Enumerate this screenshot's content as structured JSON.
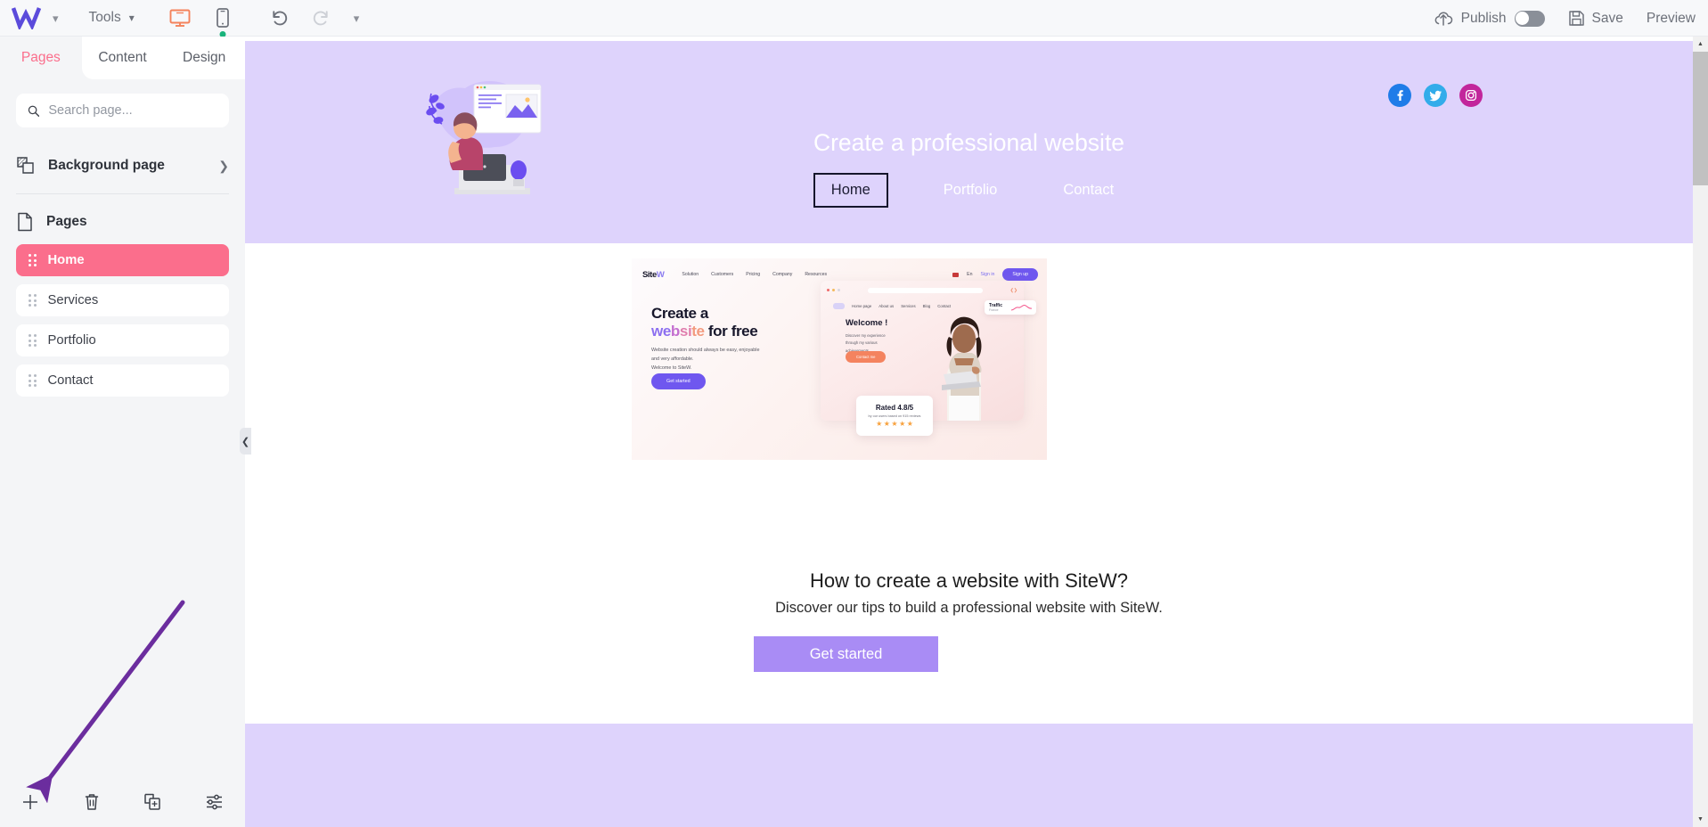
{
  "topbar": {
    "logo": "W",
    "logo_caret_icon": "chevron-down-icon",
    "tools_label": "Tools",
    "tools_caret_icon": "chevron-down-icon",
    "desktop_icon": "desktop-monitor-icon",
    "mobile_icon": "mobile-phone-icon",
    "undo_icon": "undo-arrow-icon",
    "redo_icon": "redo-arrow-icon",
    "more_caret_icon": "chevron-down-icon",
    "publish_label": "Publish",
    "publish_toggle_state": "off",
    "save_label": "Save",
    "save_icon": "floppy-disk-icon",
    "preview_label": "Preview",
    "active_device": "desktop",
    "accent_orange": "#f4825b",
    "status_dot_color": "#19b37b"
  },
  "sidebar": {
    "tabs": [
      {
        "label": "Pages",
        "active": true
      },
      {
        "label": "Content",
        "active": false
      },
      {
        "label": "Design",
        "active": false
      }
    ],
    "search": {
      "value": "",
      "placeholder": "Search page...",
      "icon": "search-icon"
    },
    "background_page": {
      "label": "Background page",
      "icon": "layers-icon",
      "chevron": "chevron-right-icon"
    },
    "pages_header": {
      "label": "Pages",
      "icon": "page-document-icon"
    },
    "pages": [
      {
        "label": "Home",
        "active": true
      },
      {
        "label": "Services",
        "active": false
      },
      {
        "label": "Portfolio",
        "active": false
      },
      {
        "label": "Contact",
        "active": false
      }
    ],
    "active_color": "#fb6e8c",
    "bottom_actions": [
      {
        "name": "add-page-button",
        "icon": "plus-icon"
      },
      {
        "name": "delete-page-button",
        "icon": "trash-icon"
      },
      {
        "name": "duplicate-page-button",
        "icon": "duplicate-icon"
      },
      {
        "name": "page-settings-button",
        "icon": "sliders-icon"
      }
    ],
    "collapse_icon": "chevron-left-icon"
  },
  "canvas": {
    "header": {
      "title": "Create a professional website",
      "background_color": "#ded3fc",
      "nav": [
        {
          "label": "Home",
          "selected": true
        },
        {
          "label": "Portfolio",
          "selected": false
        },
        {
          "label": "Contact",
          "selected": false
        }
      ],
      "socials": [
        {
          "name": "facebook-icon",
          "glyph": "f",
          "color": "#1f7ce8"
        },
        {
          "name": "twitter-icon",
          "glyph": "t",
          "color": "#32acea"
        },
        {
          "name": "instagram-icon",
          "glyph": "ig",
          "color": "#c2269b"
        }
      ],
      "illustration": "woman-at-desk-with-laptop-illustration"
    },
    "embedded_screenshot": {
      "brand": "SiteW",
      "nav_links": [
        "Solution",
        "Customers",
        "Pricing",
        "Company",
        "Resources"
      ],
      "language": "En",
      "sign_in": "Sign in",
      "sign_up": "Sign up",
      "heading_line1": "Create a",
      "heading_word_website": "website",
      "heading_line2_tail": " for free",
      "subtext": "Website creation should always be easy, enjoyable and very affordable.\nWelcome to SiteW.",
      "cta": "Get started",
      "mockup": {
        "nav": [
          "Home page",
          "About us",
          "Services",
          "Blog",
          "Contact"
        ],
        "welcome": "Welcome !",
        "paragraph": "Discover my experience through my various achievements.",
        "button": "Contact me",
        "traffic_title": "Traffic",
        "traffic_sub": "France",
        "rated_title": "Rated 4.8/5",
        "rated_sub": "by our users based on 915 reviews",
        "stars": 5
      }
    },
    "section_title": "How to create a website with SiteW?",
    "section_subtitle": "Discover our tips to build a professional website with SiteW.",
    "cta_button": "Get started",
    "cta_color": "#a98cf5",
    "footer_color": "#ded3fc"
  },
  "scrollbar": {
    "up_icon": "caret-up-icon",
    "down_icon": "caret-down-icon",
    "thumb": "vertical-scroll-thumb"
  },
  "annotation": {
    "arrow_color": "#6b2d9e",
    "points_to": "add-page-button"
  }
}
